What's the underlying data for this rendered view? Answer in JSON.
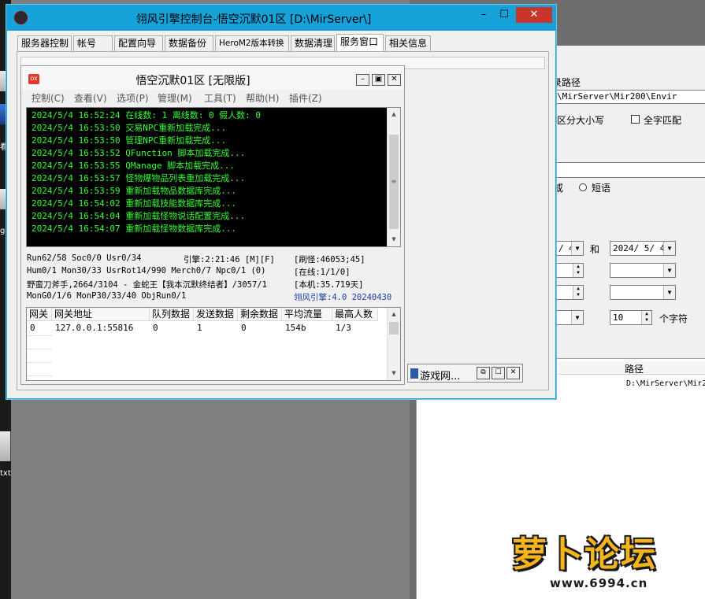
{
  "main_window": {
    "title": "翎风引擎控制台-悟空沉默01区 [D:\\MirServer\\]",
    "controls": {
      "minimize": "–",
      "maximize": "☐",
      "close": "✕"
    }
  },
  "tabs": [
    {
      "label": "服务器控制"
    },
    {
      "label": "帐号"
    },
    {
      "label": "配置向导"
    },
    {
      "label": "数据备份"
    },
    {
      "label": "HeroM2版本转换"
    },
    {
      "label": "数据清理"
    },
    {
      "label": "服务窗口"
    },
    {
      "label": "相关信息"
    }
  ],
  "inner_window": {
    "icon_text": "DX",
    "title": "悟空沉默01区 [无限版]",
    "controls": {
      "minimize": "–",
      "restore": "▣",
      "close": "✕"
    },
    "menu": [
      {
        "label": "控制(C)"
      },
      {
        "label": "查看(V)"
      },
      {
        "label": "选项(P)"
      },
      {
        "label": "管理(M)"
      },
      {
        "label": "工具(T)"
      },
      {
        "label": "帮助(H)"
      },
      {
        "label": "插件(Z)"
      }
    ],
    "log": [
      "2024/5/4 16:52:24 在线数: 1 离线数: 0 假人数: 0",
      "2024/5/4 16:53:50 交易NPC重新加载完成...",
      "2024/5/4 16:53:50 管理NPC重新加载完成...",
      "2024/5/4 16:53:52 QFunction 脚本加载完成...",
      "2024/5/4 16:53:55 QManage 脚本加载完成...",
      "2024/5/4 16:53:57 怪物爆物品列表重加载完成...",
      "2024/5/4 16:53:59 重新加载物品数据库完成...",
      "2024/5/4 16:54:02 重新加载技能数据库完成...",
      "2024/5/4 16:54:04 重新加载怪物说话配置完成...",
      "2024/5/4 16:54:07 重新加载怪物数据库完成..."
    ],
    "status": {
      "line1_left": "Run62/58 Soc0/0 Usr0/34",
      "line1_mid": "引擎:2:21:46 [M][F]",
      "line1_right": "[刷怪:46053;45]",
      "line2_left": "Hum0/1 Mon30/33 UsrRot14/990 Merch0/7 Npc0/1 (0)",
      "line2_right": "[在线:1/1/0]",
      "line3_left": "野蛮刀斧手,2664/3104 - 金蛇王【我本沉默终结者】/3057/1",
      "line3_right": "[本机:35.719天]",
      "line4_left": "MonG0/1/6 MonP30/33/40 ObjRun0/1",
      "line4_right": "翎风引擎:4.0 20240430"
    },
    "gateway_table": {
      "headers": [
        "网关",
        "网关地址",
        "队列数据",
        "发送数据",
        "剩余数据",
        "平均流量",
        "最高人数"
      ],
      "rows": [
        [
          "0",
          "127.0.0.1:55816",
          "0",
          "1",
          "0",
          "154b",
          "1/3"
        ]
      ]
    }
  },
  "minimized_window": {
    "title": "游戏网...",
    "controls": {
      "restore": "⧉",
      "maximize": "☐",
      "close": "✕"
    }
  },
  "search_window": {
    "path_label": "录路径",
    "path_value": "\\MirServer\\Mir200\\Envir",
    "case_label": "区分大小写",
    "whole_label": "全字匹配",
    "phrase_label": "或",
    "short_label": "短语",
    "date_from": "/ 4",
    "and_label": "和",
    "date_to": "2024/ 5/ 4",
    "count_value": "10",
    "chars_label": "个字符",
    "col_path": "路径",
    "result_path": "D:\\MirServer\\Mir2"
  },
  "desktop": {
    "label_g": "g.",
    "label_txt": "txt",
    "label_mark": "看"
  },
  "watermark": {
    "text": "萝卜论坛",
    "url": "www.6994.cn"
  },
  "colors": {
    "titlebar": "#16a2d9",
    "log_bg": "#000000",
    "log_text": "#33ff33",
    "close_btn": "#c7352b"
  }
}
